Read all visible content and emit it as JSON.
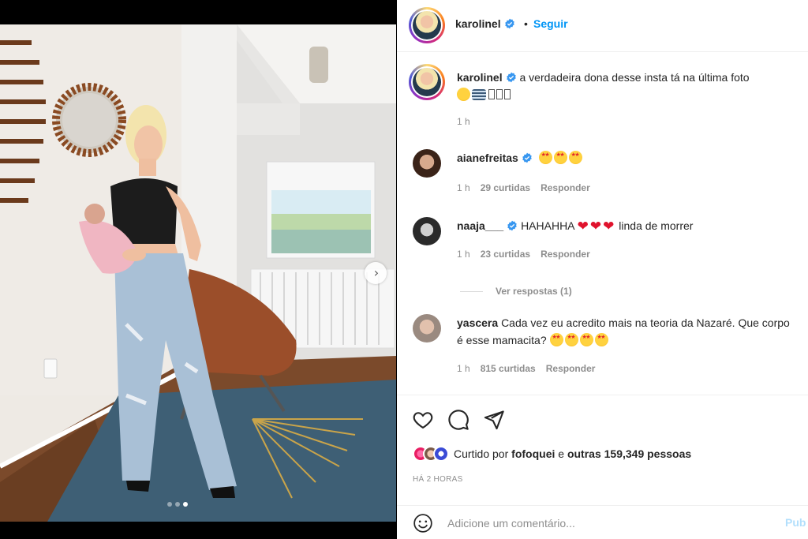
{
  "post": {
    "author": "karolinel",
    "follow_label": "Seguir",
    "separator": "•",
    "caption": {
      "text": "a verdadeira dona desse insta tá na última foto",
      "time": "1 h"
    },
    "comments": [
      {
        "user": "aianefreitas",
        "emoji": [
          "star-struck",
          "star-struck",
          "star-struck"
        ],
        "time": "1 h",
        "likes": "29 curtidas",
        "reply": "Responder"
      },
      {
        "user": "naaja___",
        "text": "HAHAHHA",
        "hearts": 3,
        "text_after": "linda de morrer",
        "time": "1 h",
        "likes": "23 curtidas",
        "reply": "Responder"
      },
      {
        "user": "yascera",
        "text": "Cada vez eu acredito mais na teoria da Nazaré. Que corpo é esse mamacita?",
        "emoji": [
          "star-struck",
          "star-struck",
          "star-struck",
          "star-struck"
        ],
        "time": "1 h",
        "likes": "815 curtidas",
        "reply": "Responder"
      }
    ],
    "view_replies": "Ver respostas (1)",
    "likes": {
      "prefix": "Curtido por",
      "user": "fofoquei",
      "middle": "e",
      "others": "outras 159,349 pessoas"
    },
    "posted_ago": "HÁ 2 HORAS",
    "comment_placeholder": "Adicione um comentário...",
    "publish_label": "Pub",
    "carousel": {
      "slides": 3,
      "active_slide": 3
    }
  },
  "colors": {
    "link_blue": "#0095f6",
    "verified_blue": "#3897f0",
    "muted": "#8e8e8e",
    "publish_disabled": "#b2dffc"
  },
  "icons": [
    "verified-icon",
    "heart-icon",
    "comment-icon",
    "share-icon",
    "emoji-icon",
    "chevron-right-icon"
  ]
}
